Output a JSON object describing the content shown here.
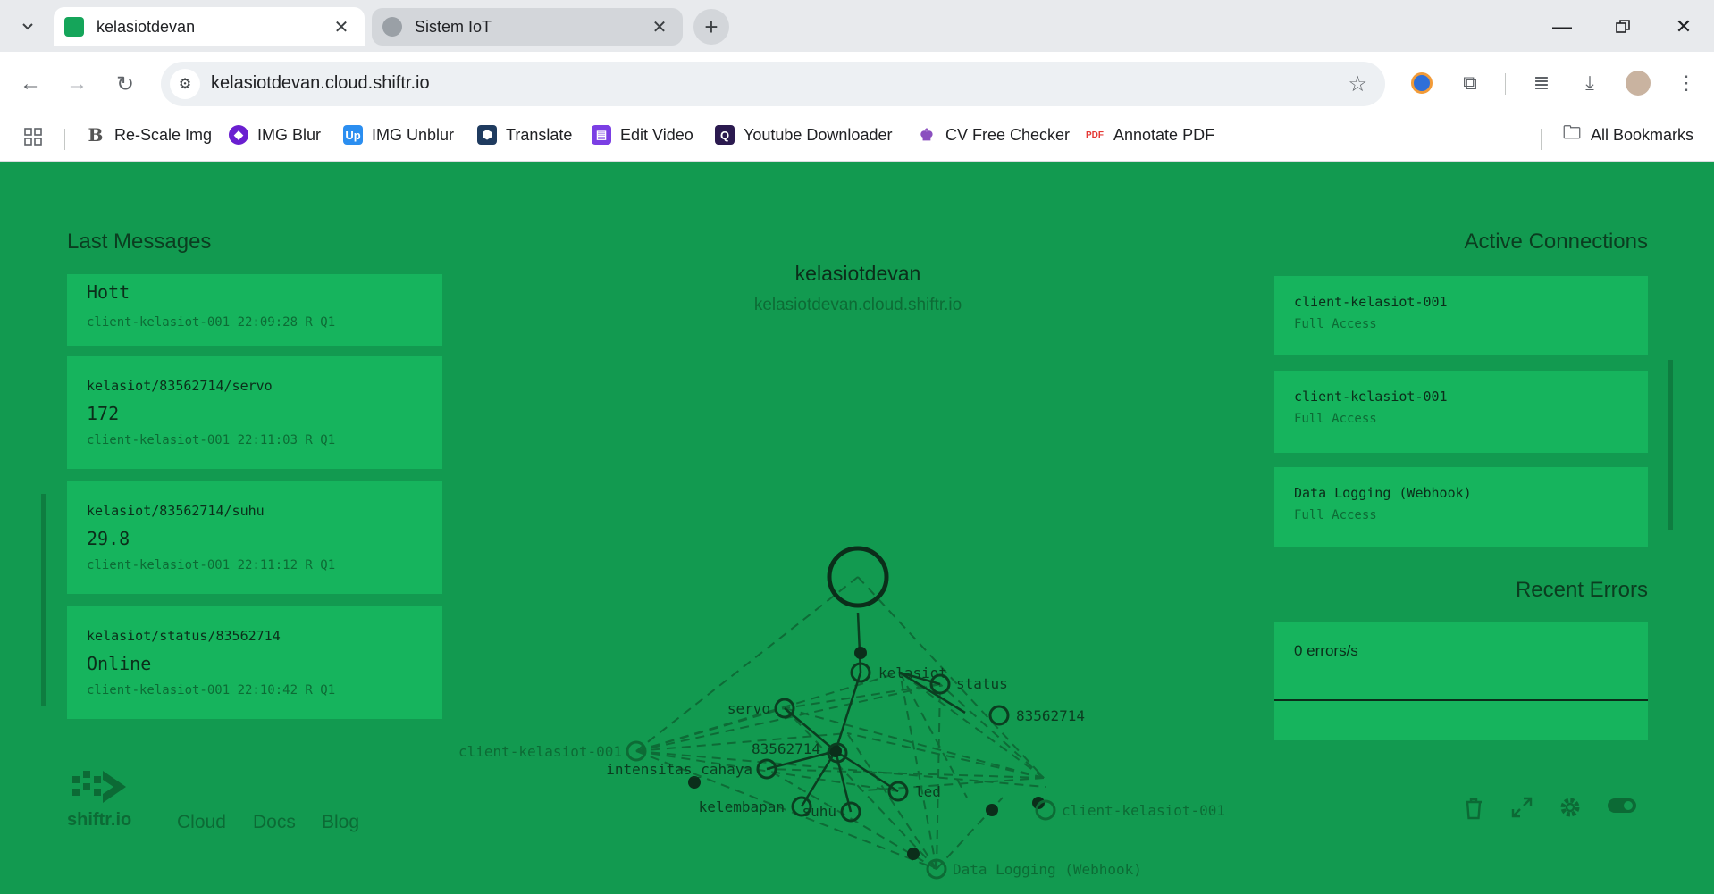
{
  "browser": {
    "tabs": [
      {
        "title": "kelasiotdevan",
        "active": true
      },
      {
        "title": "Sistem IoT",
        "active": false
      }
    ],
    "url": "kelasiotdevan.cloud.shiftr.io",
    "bookmarks": [
      {
        "label": "Re-Scale Img",
        "icon": "rescale-icon",
        "color": "#ffffff"
      },
      {
        "label": "IMG Blur",
        "icon": "img-blur-icon",
        "color": "#6a1fd0"
      },
      {
        "label": "IMG Unblur",
        "icon": "img-unblur-icon",
        "color": "#2b8ef0"
      },
      {
        "label": "Translate",
        "icon": "translate-icon",
        "color": "#1f3b5f"
      },
      {
        "label": "Edit Video",
        "icon": "edit-video-icon",
        "color": "#7b3fe4"
      },
      {
        "label": "Youtube Downloader",
        "icon": "youtube-downloader-icon",
        "color": "#2b1a4f"
      },
      {
        "label": "CV Free Checker",
        "icon": "cv-checker-icon",
        "color": "#8a4fbf"
      },
      {
        "label": "Annotate PDF",
        "icon": "pdf-icon",
        "color": "#e53935"
      }
    ],
    "all_bookmarks": "All Bookmarks"
  },
  "page": {
    "last_messages_title": "Last Messages",
    "active_connections_title": "Active Connections",
    "recent_errors_title": "Recent Errors",
    "broker_name": "kelasiotdevan",
    "broker_host": "kelasiotdevan.cloud.shiftr.io",
    "messages": [
      {
        "topic": "",
        "payload": "Hott",
        "meta": "client-kelasiot-001 22:09:28 R Q1"
      },
      {
        "topic": "kelasiot/83562714/servo",
        "payload": "172",
        "meta": "client-kelasiot-001 22:11:03 R Q1"
      },
      {
        "topic": "kelasiot/83562714/suhu",
        "payload": "29.8",
        "meta": "client-kelasiot-001 22:11:12 R Q1"
      },
      {
        "topic": "kelasiot/status/83562714",
        "payload": "Online",
        "meta": "client-kelasiot-001 22:10:42 R Q1"
      }
    ],
    "connections": [
      {
        "name": "client-kelasiot-001",
        "access": "Full Access"
      },
      {
        "name": "client-kelasiot-001",
        "access": "Full Access"
      },
      {
        "name": "Data Logging (Webhook)",
        "access": "Full Access"
      }
    ],
    "errors_rate": "0 errors/s",
    "footer": {
      "logo_text": "shiftr.io",
      "links": [
        "Cloud",
        "Docs",
        "Blog"
      ]
    },
    "graph_labels": {
      "kelasiot": "kelasiot",
      "status": "status",
      "id_right": "83562714",
      "servo": "servo",
      "id_center": "83562714",
      "client_left": "client-kelasiot-001",
      "intensitas": "intensitas_cahaya",
      "led": "led",
      "kelembapan": "kelembapan",
      "suhu": "suhu",
      "client_right": "client-kelasiot-001",
      "webhook": "Data Logging (Webhook)"
    },
    "colors": {
      "background": "#129a50",
      "card": "#16b45d",
      "dark": "#0b2e1a"
    }
  }
}
